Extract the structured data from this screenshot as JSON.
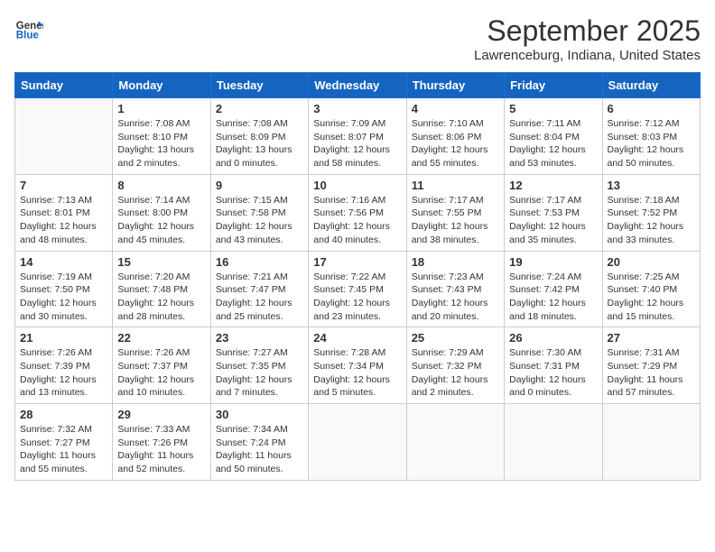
{
  "header": {
    "logo_line1": "General",
    "logo_line2": "Blue",
    "month": "September 2025",
    "location": "Lawrenceburg, Indiana, United States"
  },
  "weekdays": [
    "Sunday",
    "Monday",
    "Tuesday",
    "Wednesday",
    "Thursday",
    "Friday",
    "Saturday"
  ],
  "weeks": [
    [
      {
        "day": "",
        "info": ""
      },
      {
        "day": "1",
        "info": "Sunrise: 7:08 AM\nSunset: 8:10 PM\nDaylight: 13 hours\nand 2 minutes."
      },
      {
        "day": "2",
        "info": "Sunrise: 7:08 AM\nSunset: 8:09 PM\nDaylight: 13 hours\nand 0 minutes."
      },
      {
        "day": "3",
        "info": "Sunrise: 7:09 AM\nSunset: 8:07 PM\nDaylight: 12 hours\nand 58 minutes."
      },
      {
        "day": "4",
        "info": "Sunrise: 7:10 AM\nSunset: 8:06 PM\nDaylight: 12 hours\nand 55 minutes."
      },
      {
        "day": "5",
        "info": "Sunrise: 7:11 AM\nSunset: 8:04 PM\nDaylight: 12 hours\nand 53 minutes."
      },
      {
        "day": "6",
        "info": "Sunrise: 7:12 AM\nSunset: 8:03 PM\nDaylight: 12 hours\nand 50 minutes."
      }
    ],
    [
      {
        "day": "7",
        "info": "Sunrise: 7:13 AM\nSunset: 8:01 PM\nDaylight: 12 hours\nand 48 minutes."
      },
      {
        "day": "8",
        "info": "Sunrise: 7:14 AM\nSunset: 8:00 PM\nDaylight: 12 hours\nand 45 minutes."
      },
      {
        "day": "9",
        "info": "Sunrise: 7:15 AM\nSunset: 7:58 PM\nDaylight: 12 hours\nand 43 minutes."
      },
      {
        "day": "10",
        "info": "Sunrise: 7:16 AM\nSunset: 7:56 PM\nDaylight: 12 hours\nand 40 minutes."
      },
      {
        "day": "11",
        "info": "Sunrise: 7:17 AM\nSunset: 7:55 PM\nDaylight: 12 hours\nand 38 minutes."
      },
      {
        "day": "12",
        "info": "Sunrise: 7:17 AM\nSunset: 7:53 PM\nDaylight: 12 hours\nand 35 minutes."
      },
      {
        "day": "13",
        "info": "Sunrise: 7:18 AM\nSunset: 7:52 PM\nDaylight: 12 hours\nand 33 minutes."
      }
    ],
    [
      {
        "day": "14",
        "info": "Sunrise: 7:19 AM\nSunset: 7:50 PM\nDaylight: 12 hours\nand 30 minutes."
      },
      {
        "day": "15",
        "info": "Sunrise: 7:20 AM\nSunset: 7:48 PM\nDaylight: 12 hours\nand 28 minutes."
      },
      {
        "day": "16",
        "info": "Sunrise: 7:21 AM\nSunset: 7:47 PM\nDaylight: 12 hours\nand 25 minutes."
      },
      {
        "day": "17",
        "info": "Sunrise: 7:22 AM\nSunset: 7:45 PM\nDaylight: 12 hours\nand 23 minutes."
      },
      {
        "day": "18",
        "info": "Sunrise: 7:23 AM\nSunset: 7:43 PM\nDaylight: 12 hours\nand 20 minutes."
      },
      {
        "day": "19",
        "info": "Sunrise: 7:24 AM\nSunset: 7:42 PM\nDaylight: 12 hours\nand 18 minutes."
      },
      {
        "day": "20",
        "info": "Sunrise: 7:25 AM\nSunset: 7:40 PM\nDaylight: 12 hours\nand 15 minutes."
      }
    ],
    [
      {
        "day": "21",
        "info": "Sunrise: 7:26 AM\nSunset: 7:39 PM\nDaylight: 12 hours\nand 13 minutes."
      },
      {
        "day": "22",
        "info": "Sunrise: 7:26 AM\nSunset: 7:37 PM\nDaylight: 12 hours\nand 10 minutes."
      },
      {
        "day": "23",
        "info": "Sunrise: 7:27 AM\nSunset: 7:35 PM\nDaylight: 12 hours\nand 7 minutes."
      },
      {
        "day": "24",
        "info": "Sunrise: 7:28 AM\nSunset: 7:34 PM\nDaylight: 12 hours\nand 5 minutes."
      },
      {
        "day": "25",
        "info": "Sunrise: 7:29 AM\nSunset: 7:32 PM\nDaylight: 12 hours\nand 2 minutes."
      },
      {
        "day": "26",
        "info": "Sunrise: 7:30 AM\nSunset: 7:31 PM\nDaylight: 12 hours\nand 0 minutes."
      },
      {
        "day": "27",
        "info": "Sunrise: 7:31 AM\nSunset: 7:29 PM\nDaylight: 11 hours\nand 57 minutes."
      }
    ],
    [
      {
        "day": "28",
        "info": "Sunrise: 7:32 AM\nSunset: 7:27 PM\nDaylight: 11 hours\nand 55 minutes."
      },
      {
        "day": "29",
        "info": "Sunrise: 7:33 AM\nSunset: 7:26 PM\nDaylight: 11 hours\nand 52 minutes."
      },
      {
        "day": "30",
        "info": "Sunrise: 7:34 AM\nSunset: 7:24 PM\nDaylight: 11 hours\nand 50 minutes."
      },
      {
        "day": "",
        "info": ""
      },
      {
        "day": "",
        "info": ""
      },
      {
        "day": "",
        "info": ""
      },
      {
        "day": "",
        "info": ""
      }
    ]
  ]
}
